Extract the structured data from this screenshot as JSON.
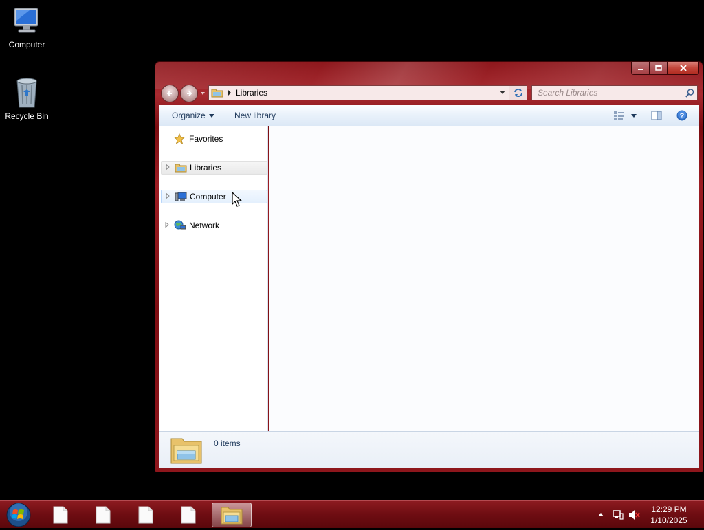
{
  "desktop": {
    "icons": [
      {
        "label": "Computer"
      },
      {
        "label": "Recycle Bin"
      }
    ]
  },
  "window": {
    "caption": {
      "minimize": "—",
      "maximize": "□",
      "close": "X"
    },
    "address": {
      "crumb": "Libraries"
    },
    "search": {
      "placeholder": "Search Libraries"
    },
    "toolbar": {
      "organize": "Organize",
      "new_library": "New library"
    },
    "nav_pane": {
      "favorites": "Favorites",
      "libraries": "Libraries",
      "computer": "Computer",
      "network": "Network"
    },
    "details": {
      "items_count": "0 items"
    }
  },
  "taskbar": {
    "clock_time": "12:29 PM",
    "clock_date": "1/10/2025"
  },
  "colors": {
    "window_frame": "#8c1318",
    "taskbar": "#6e0d12",
    "command_bar": "#dce8f6",
    "selection": "#e4f0fd"
  }
}
